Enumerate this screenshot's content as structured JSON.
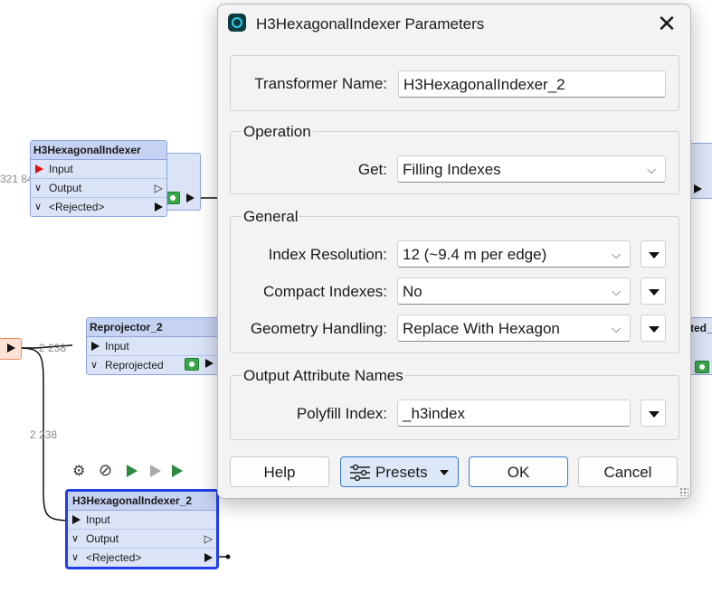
{
  "canvas": {
    "node1": {
      "title": "H3HexagonalIndexer",
      "ports": [
        "Input",
        "Output",
        "<Rejected>"
      ]
    },
    "node2": {
      "title": "Reprojector_2",
      "ports": [
        "Input",
        "Reprojected"
      ]
    },
    "node3": {
      "title": "H3HexagonalIndexer_2",
      "ports": [
        "Input",
        "Output",
        "<Rejected>"
      ]
    },
    "feature_counts": {
      "left_partial": "321 84",
      "link_a": "2 238",
      "link_b": "2 238"
    },
    "right_partial_text": "ted_"
  },
  "dialog": {
    "title": "H3HexagonalIndexer Parameters",
    "close_label": "✕",
    "transformer_name_label": "Transformer Name:",
    "transformer_name_value": "H3HexagonalIndexer_2",
    "operation": {
      "group_title": "Operation",
      "get_label": "Get:",
      "get_value": "Filling Indexes"
    },
    "general": {
      "group_title": "General",
      "index_resolution_label": "Index Resolution:",
      "index_resolution_value": "12 (~9.4 m per edge)",
      "compact_indexes_label": "Compact Indexes:",
      "compact_indexes_value": "No",
      "geometry_handling_label": "Geometry Handling:",
      "geometry_handling_value": "Replace With Hexagon"
    },
    "output_attributes": {
      "group_title": "Output Attribute Names",
      "polyfill_index_label": "Polyfill Index:",
      "polyfill_index_value": "_h3index"
    },
    "buttons": {
      "help": "Help",
      "presets": "Presets",
      "ok": "OK",
      "cancel": "Cancel"
    }
  },
  "icons": [
    "gear-icon",
    "disable-icon",
    "run-to-icon",
    "run-from-icon",
    "run-only-icon",
    "dropdown-arrow-icon",
    "chevron-down-icon",
    "presets-sliders-icon"
  ],
  "colors": {
    "accent": "#3578d4",
    "selection": "#1f3ee6",
    "node_fill": "#dbe3f7",
    "node_header": "#c6d2f2",
    "input_port": "#dd1111",
    "inspect_green": "#3aa64a"
  }
}
